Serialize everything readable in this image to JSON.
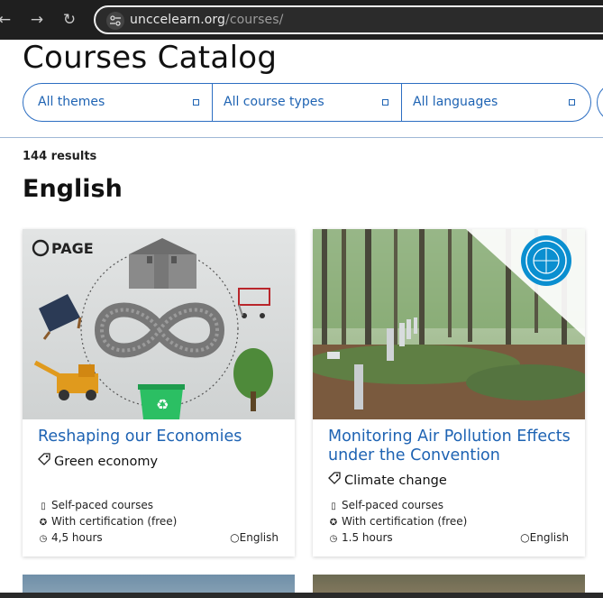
{
  "browser": {
    "url_host": "unccelearn.org",
    "url_path": "/courses/"
  },
  "page": {
    "title": "Courses Catalog",
    "filters": [
      "All themes",
      "All course types",
      "All languages"
    ],
    "results": "144 results",
    "section": "English"
  },
  "cards": [
    {
      "logo_text": "PAGE",
      "title": "Reshaping our Economies",
      "tag": "Green economy",
      "course_type": "Self-paced courses",
      "certification": "With certification (free)",
      "duration": "4,5 hours",
      "language": "English"
    },
    {
      "title": "Monitoring Air Pollution Effects under the Convention",
      "tag": "Climate change",
      "course_type": "Self-paced courses",
      "certification": "With certification (free)",
      "duration": "1.5 hours",
      "language": "English"
    }
  ],
  "colors": {
    "link": "#1e63b3",
    "filter_border": "#2c6ec2"
  }
}
